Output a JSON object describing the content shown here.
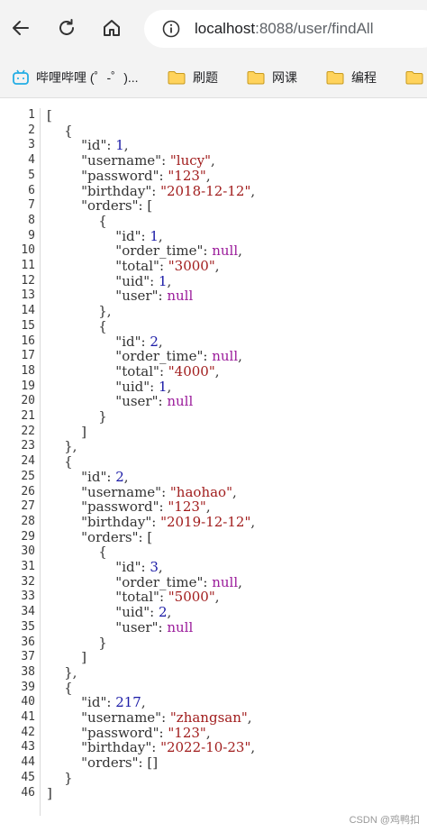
{
  "browser": {
    "url_host": "localhost",
    "url_rest": ":8088/user/findAll"
  },
  "bookmarks": [
    {
      "label": "哔哩哔哩 (゜-゜)...",
      "icon": "bilibili-icon"
    },
    {
      "label": "刷题",
      "icon": "folder-icon"
    },
    {
      "label": "网课",
      "icon": "folder-icon"
    },
    {
      "label": "编程",
      "icon": "folder-icon"
    },
    {
      "label": "",
      "icon": "folder-icon"
    }
  ],
  "json_lines": [
    [
      [
        "p",
        "["
      ]
    ],
    [
      [
        "p",
        "    {"
      ]
    ],
    [
      [
        "p",
        "        "
      ],
      [
        "k",
        "\"id\""
      ],
      [
        "p",
        ": "
      ],
      [
        "n",
        "1"
      ],
      [
        "p",
        ","
      ]
    ],
    [
      [
        "p",
        "        "
      ],
      [
        "k",
        "\"username\""
      ],
      [
        "p",
        ": "
      ],
      [
        "s",
        "\"lucy\""
      ],
      [
        "p",
        ","
      ]
    ],
    [
      [
        "p",
        "        "
      ],
      [
        "k",
        "\"password\""
      ],
      [
        "p",
        ": "
      ],
      [
        "s",
        "\"123\""
      ],
      [
        "p",
        ","
      ]
    ],
    [
      [
        "p",
        "        "
      ],
      [
        "k",
        "\"birthday\""
      ],
      [
        "p",
        ": "
      ],
      [
        "s",
        "\"2018-12-12\""
      ],
      [
        "p",
        ","
      ]
    ],
    [
      [
        "p",
        "        "
      ],
      [
        "k",
        "\"orders\""
      ],
      [
        "p",
        ": ["
      ]
    ],
    [
      [
        "p",
        "            {"
      ]
    ],
    [
      [
        "p",
        "                "
      ],
      [
        "k",
        "\"id\""
      ],
      [
        "p",
        ": "
      ],
      [
        "n",
        "1"
      ],
      [
        "p",
        ","
      ]
    ],
    [
      [
        "p",
        "                "
      ],
      [
        "k",
        "\"order_time\""
      ],
      [
        "p",
        ": "
      ],
      [
        "nl",
        "null"
      ],
      [
        "p",
        ","
      ]
    ],
    [
      [
        "p",
        "                "
      ],
      [
        "k",
        "\"total\""
      ],
      [
        "p",
        ": "
      ],
      [
        "s",
        "\"3000\""
      ],
      [
        "p",
        ","
      ]
    ],
    [
      [
        "p",
        "                "
      ],
      [
        "k",
        "\"uid\""
      ],
      [
        "p",
        ": "
      ],
      [
        "n",
        "1"
      ],
      [
        "p",
        ","
      ]
    ],
    [
      [
        "p",
        "                "
      ],
      [
        "k",
        "\"user\""
      ],
      [
        "p",
        ": "
      ],
      [
        "nl",
        "null"
      ]
    ],
    [
      [
        "p",
        "            },"
      ]
    ],
    [
      [
        "p",
        "            {"
      ]
    ],
    [
      [
        "p",
        "                "
      ],
      [
        "k",
        "\"id\""
      ],
      [
        "p",
        ": "
      ],
      [
        "n",
        "2"
      ],
      [
        "p",
        ","
      ]
    ],
    [
      [
        "p",
        "                "
      ],
      [
        "k",
        "\"order_time\""
      ],
      [
        "p",
        ": "
      ],
      [
        "nl",
        "null"
      ],
      [
        "p",
        ","
      ]
    ],
    [
      [
        "p",
        "                "
      ],
      [
        "k",
        "\"total\""
      ],
      [
        "p",
        ": "
      ],
      [
        "s",
        "\"4000\""
      ],
      [
        "p",
        ","
      ]
    ],
    [
      [
        "p",
        "                "
      ],
      [
        "k",
        "\"uid\""
      ],
      [
        "p",
        ": "
      ],
      [
        "n",
        "1"
      ],
      [
        "p",
        ","
      ]
    ],
    [
      [
        "p",
        "                "
      ],
      [
        "k",
        "\"user\""
      ],
      [
        "p",
        ": "
      ],
      [
        "nl",
        "null"
      ]
    ],
    [
      [
        "p",
        "            }"
      ]
    ],
    [
      [
        "p",
        "        ]"
      ]
    ],
    [
      [
        "p",
        "    },"
      ]
    ],
    [
      [
        "p",
        "    {"
      ]
    ],
    [
      [
        "p",
        "        "
      ],
      [
        "k",
        "\"id\""
      ],
      [
        "p",
        ": "
      ],
      [
        "n",
        "2"
      ],
      [
        "p",
        ","
      ]
    ],
    [
      [
        "p",
        "        "
      ],
      [
        "k",
        "\"username\""
      ],
      [
        "p",
        ": "
      ],
      [
        "s",
        "\"haohao\""
      ],
      [
        "p",
        ","
      ]
    ],
    [
      [
        "p",
        "        "
      ],
      [
        "k",
        "\"password\""
      ],
      [
        "p",
        ": "
      ],
      [
        "s",
        "\"123\""
      ],
      [
        "p",
        ","
      ]
    ],
    [
      [
        "p",
        "        "
      ],
      [
        "k",
        "\"birthday\""
      ],
      [
        "p",
        ": "
      ],
      [
        "s",
        "\"2019-12-12\""
      ],
      [
        "p",
        ","
      ]
    ],
    [
      [
        "p",
        "        "
      ],
      [
        "k",
        "\"orders\""
      ],
      [
        "p",
        ": ["
      ]
    ],
    [
      [
        "p",
        "            {"
      ]
    ],
    [
      [
        "p",
        "                "
      ],
      [
        "k",
        "\"id\""
      ],
      [
        "p",
        ": "
      ],
      [
        "n",
        "3"
      ],
      [
        "p",
        ","
      ]
    ],
    [
      [
        "p",
        "                "
      ],
      [
        "k",
        "\"order_time\""
      ],
      [
        "p",
        ": "
      ],
      [
        "nl",
        "null"
      ],
      [
        "p",
        ","
      ]
    ],
    [
      [
        "p",
        "                "
      ],
      [
        "k",
        "\"total\""
      ],
      [
        "p",
        ": "
      ],
      [
        "s",
        "\"5000\""
      ],
      [
        "p",
        ","
      ]
    ],
    [
      [
        "p",
        "                "
      ],
      [
        "k",
        "\"uid\""
      ],
      [
        "p",
        ": "
      ],
      [
        "n",
        "2"
      ],
      [
        "p",
        ","
      ]
    ],
    [
      [
        "p",
        "                "
      ],
      [
        "k",
        "\"user\""
      ],
      [
        "p",
        ": "
      ],
      [
        "nl",
        "null"
      ]
    ],
    [
      [
        "p",
        "            }"
      ]
    ],
    [
      [
        "p",
        "        ]"
      ]
    ],
    [
      [
        "p",
        "    },"
      ]
    ],
    [
      [
        "p",
        "    {"
      ]
    ],
    [
      [
        "p",
        "        "
      ],
      [
        "k",
        "\"id\""
      ],
      [
        "p",
        ": "
      ],
      [
        "n",
        "217"
      ],
      [
        "p",
        ","
      ]
    ],
    [
      [
        "p",
        "        "
      ],
      [
        "k",
        "\"username\""
      ],
      [
        "p",
        ": "
      ],
      [
        "s",
        "\"zhangsan\""
      ],
      [
        "p",
        ","
      ]
    ],
    [
      [
        "p",
        "        "
      ],
      [
        "k",
        "\"password\""
      ],
      [
        "p",
        ": "
      ],
      [
        "s",
        "\"123\""
      ],
      [
        "p",
        ","
      ]
    ],
    [
      [
        "p",
        "        "
      ],
      [
        "k",
        "\"birthday\""
      ],
      [
        "p",
        ": "
      ],
      [
        "s",
        "\"2022-10-23\""
      ],
      [
        "p",
        ","
      ]
    ],
    [
      [
        "p",
        "        "
      ],
      [
        "k",
        "\"orders\""
      ],
      [
        "p",
        ": []"
      ]
    ],
    [
      [
        "p",
        "    }"
      ]
    ],
    [
      [
        "p",
        "]"
      ]
    ]
  ],
  "watermark": "CSDN @鸡鸭扣"
}
